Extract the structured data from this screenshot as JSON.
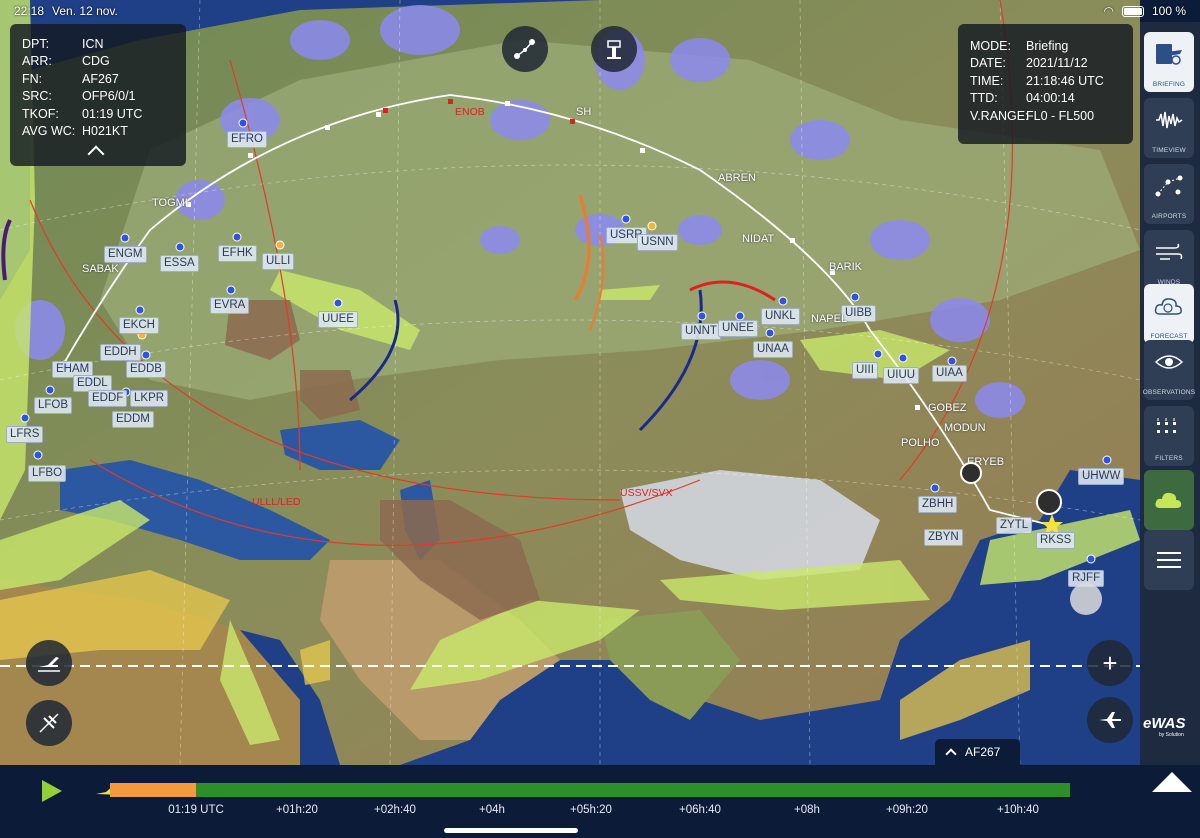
{
  "status": {
    "time": "22:18",
    "date": "Ven. 12 nov.",
    "battery": "100 %"
  },
  "left_panel": {
    "rows": [
      {
        "k": "DPT:",
        "v": "ICN"
      },
      {
        "k": "ARR:",
        "v": "CDG"
      },
      {
        "k": "FN:",
        "v": "AF267"
      },
      {
        "k": "SRC:",
        "v": "OFP6/0/1"
      },
      {
        "k": "TKOF:",
        "v": "01:19 UTC"
      },
      {
        "k": "AVG WC:",
        "v": "H021KT"
      }
    ]
  },
  "right_panel": {
    "rows": [
      {
        "k": "MODE:",
        "v": "Briefing"
      },
      {
        "k": "DATE:",
        "v": "2021/11/12"
      },
      {
        "k": "TIME:",
        "v": "21:18:46 UTC"
      },
      {
        "k": "TTD:",
        "v": "04:00:14"
      },
      {
        "k": "V.RANGE:",
        "v": "FL0 - FL500"
      }
    ]
  },
  "sidebar": {
    "items": [
      {
        "label": "BRIEFING",
        "icon": "briefing-icon"
      },
      {
        "label": "TIMEVIEW",
        "icon": "waveform-icon"
      },
      {
        "label": "AIRPORTS",
        "icon": "route-icon"
      },
      {
        "label": "WINDS",
        "icon": "wind-icon"
      },
      {
        "label": "FORECAST",
        "icon": "forecast-icon"
      },
      {
        "label": "OBSERVATIONS",
        "icon": "eye-icon"
      },
      {
        "label": "FILTERS",
        "icon": "filters-icon"
      }
    ]
  },
  "flight_tab": {
    "label": "AF267"
  },
  "brand": {
    "name": "eWAS",
    "sub": "by Solution"
  },
  "timeline": {
    "progress": 0.09,
    "ticks": [
      "01:19 UTC",
      "+01h:20",
      "+02h:40",
      "+04h",
      "+05h:20",
      "+06h:40",
      "+08h",
      "+09h:20",
      "+10h:40"
    ]
  },
  "airports": [
    "EFRO",
    "ENGM",
    "ESSA",
    "EFHK",
    "ULLI",
    "EVRA",
    "UUEE",
    "EKCH",
    "EDDH",
    "EHAM",
    "EDDB",
    "EDDL",
    "LFOB",
    "EDDF",
    "LKPR",
    "EDDM",
    "LFRS",
    "LFBO",
    "USRR",
    "USNN",
    "UNNT",
    "UNEE",
    "UNKL",
    "UNAA",
    "UIBB",
    "UIII",
    "UIUU",
    "UIAA",
    "ZBHH",
    "ZBYN",
    "ZYTL",
    "RKSS",
    "RJFF",
    "UHWW"
  ],
  "waypoints": [
    "TOGMI",
    "SABAK",
    "ABREN",
    "NIDAT",
    "BARIK",
    "NAPEL",
    "GOBEZ",
    "MODUN",
    "POLHO",
    "ERYEB",
    "SH"
  ],
  "fir_labels": [
    "ENOB",
    "ULLL/LED",
    "USSV/SVX"
  ],
  "colors": {
    "timeline_past": "#f39a3c",
    "timeline_future": "#2e8f2a",
    "route": "#ffffff",
    "fir": "#e02020"
  }
}
